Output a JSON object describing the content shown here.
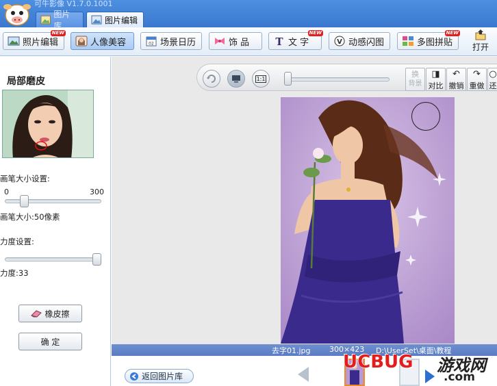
{
  "app": {
    "title": "可牛影像  V1.7.0.1001"
  },
  "tabs": [
    {
      "label": "图片库",
      "active": false
    },
    {
      "label": "图片编辑",
      "active": true
    }
  ],
  "toolbar": {
    "items": [
      {
        "label": "照片编辑",
        "icon": "photo-edit-icon",
        "new": true,
        "active": false
      },
      {
        "label": "人像美容",
        "icon": "portrait-icon",
        "new": false,
        "active": true
      },
      {
        "label": "场景日历",
        "icon": "calendar-icon",
        "new": false,
        "active": false
      },
      {
        "label": "饰  品",
        "icon": "bow-icon",
        "new": false,
        "active": false
      },
      {
        "label": "文  字",
        "icon": "text-icon",
        "new": true,
        "active": false
      },
      {
        "label": "动感闪图",
        "icon": "flash-icon",
        "new": false,
        "active": false
      },
      {
        "label": "多图拼贴",
        "icon": "collage-icon",
        "new": true,
        "active": false
      }
    ],
    "new_badge": "NEW",
    "open_label": "打开"
  },
  "left_panel": {
    "title": "局部磨皮",
    "brush_size_label": "画笔大小设置:",
    "brush_min": "0",
    "brush_max": "300",
    "brush_value_text": "画笔大小:50像素",
    "brush_value_fraction": 0.17,
    "strength_label": "力度设置:",
    "strength_value_text": "力度:33",
    "strength_value_fraction": 1.0,
    "eraser_label": "橡皮擦",
    "confirm_label": "确  定"
  },
  "view_toolbar": {
    "zoom_fraction": 0.0,
    "actual_size_label": "1:1",
    "buttons": [
      {
        "label": "换\n背景",
        "icon": "swap-bg-icon",
        "disabled": true
      },
      {
        "label": "对比",
        "icon": "compare-icon",
        "disabled": false
      },
      {
        "label": "撤销",
        "icon": "undo-icon",
        "disabled": false
      },
      {
        "label": "重做",
        "icon": "redo-icon",
        "disabled": false
      },
      {
        "label": "还",
        "icon": "restore-icon",
        "disabled": false
      }
    ]
  },
  "status": {
    "filename": "去字01.jpg",
    "dimensions": "300×423",
    "path": "D:\\UserSet\\桌面\\教程"
  },
  "bottom": {
    "back_label": "返回图片库"
  },
  "watermark": {
    "brand": "UCBUG",
    "cn": "游戏网",
    "domain": ".com"
  },
  "colors": {
    "accent_blue": "#3a78cf",
    "status_blue": "#5a7cc4",
    "new_badge_red": "#e02020",
    "dress_purple": "#3a2a8c",
    "photo_bg": "#b79bd0"
  }
}
